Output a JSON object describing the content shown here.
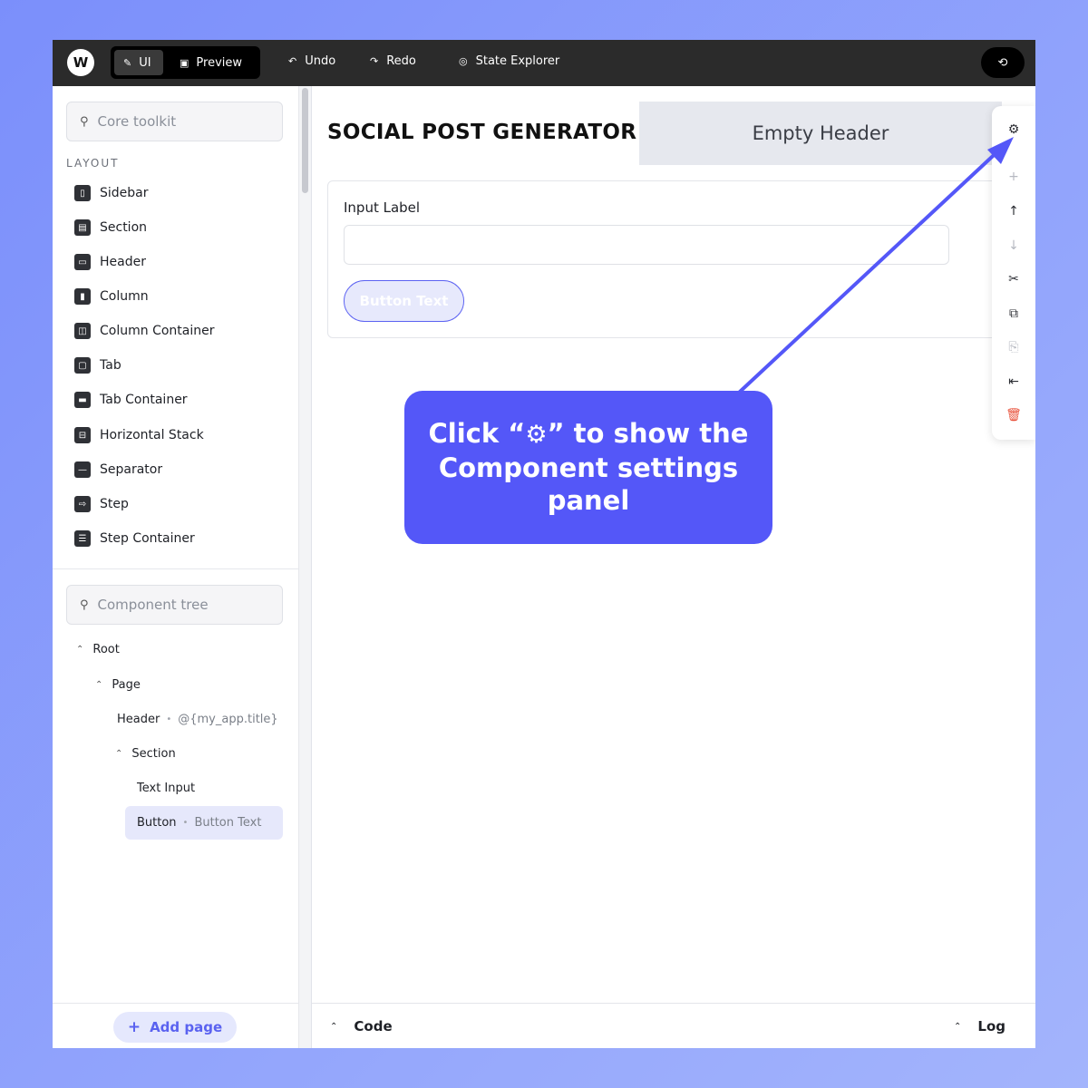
{
  "topbar": {
    "logo": "W",
    "modes": [
      {
        "label": "UI",
        "icon": "brush-icon"
      },
      {
        "label": "Preview",
        "icon": "preview-icon"
      }
    ],
    "undo": "Undo",
    "redo": "Redo",
    "state_explorer": "State Explorer"
  },
  "sidebar": {
    "toolkit_search_placeholder": "Core toolkit",
    "layout_label": "LAYOUT",
    "layout_items": [
      {
        "label": "Sidebar",
        "glyph": "▯"
      },
      {
        "label": "Section",
        "glyph": "▤"
      },
      {
        "label": "Header",
        "glyph": "▭"
      },
      {
        "label": "Column",
        "glyph": "▮"
      },
      {
        "label": "Column Container",
        "glyph": "◫"
      },
      {
        "label": "Tab",
        "glyph": "▢"
      },
      {
        "label": "Tab Container",
        "glyph": "▬"
      },
      {
        "label": "Horizontal Stack",
        "glyph": "⊟"
      },
      {
        "label": "Separator",
        "glyph": "—"
      },
      {
        "label": "Step",
        "glyph": "⇨"
      },
      {
        "label": "Step Container",
        "glyph": "☰"
      }
    ],
    "tree_search_placeholder": "Component tree",
    "tree": {
      "root": "Root",
      "page": "Page",
      "header": "Header",
      "header_binding": "@{my_app.title}",
      "section": "Section",
      "text_input": "Text Input",
      "button": "Button",
      "button_text": "Button Text"
    },
    "add_page": "Add page"
  },
  "canvas": {
    "app_title": "SOCIAL POST GENERATOR",
    "empty_header": "Empty Header",
    "input_label": "Input Label",
    "button_text": "Button Text"
  },
  "bottom": {
    "code": "Code",
    "log": "Log"
  },
  "callout": {
    "line1_pre": "Click “",
    "line1_post": "” to show the",
    "line2": "Component settings",
    "line3": "panel"
  },
  "colors": {
    "accent": "#5457f8",
    "topbar": "#2b2b2b",
    "danger": "#e8503a"
  }
}
